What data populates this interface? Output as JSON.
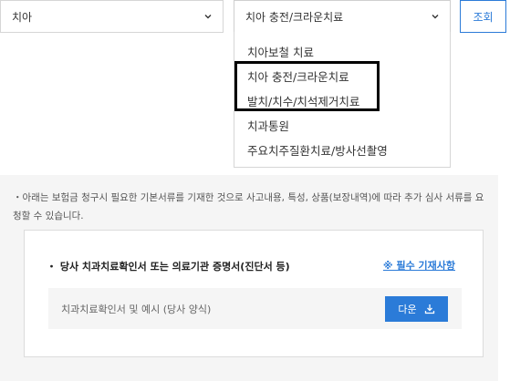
{
  "filters": {
    "category_value": "치아",
    "treatment_value": "치아 충전/크라운치료",
    "search_label": "조회"
  },
  "dropdown": {
    "options": [
      "치아보철 치료",
      "치아 충전/크라운치료",
      "발치/치수/치석제거치료",
      "치과통원",
      "주요치주질환치료/방사선촬영"
    ]
  },
  "info": {
    "notice": "・아래는 보험금 청구시 필요한 기본서류를 기재한 것으로 사고내용, 특성, 상품(보장내역)에 따라 추가 심사 서류를 요청할 수 있습니다.",
    "doc_title": "・ 당사 치과치료확인서 또는 의료기관 증명서(진단서 등)",
    "required_link": "※ 필수 기재사항",
    "doc_row_label": "치과치료확인서 및 예시 (당사 양식)",
    "download_label": "다운"
  },
  "colors": {
    "accent": "#2b7bd8",
    "panel_bg": "#f5f5f5",
    "highlight_border": "#000000"
  }
}
